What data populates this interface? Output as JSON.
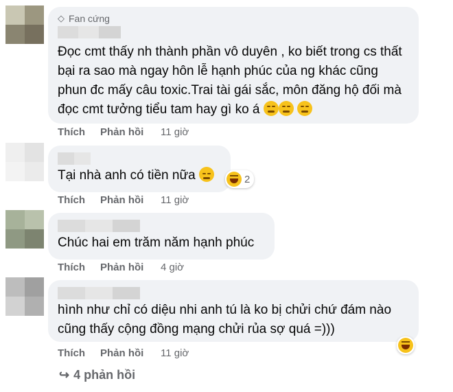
{
  "comments": [
    {
      "badge": "Fan cứng",
      "text": "Đọc cmt thấy nh thành phần vô duyên       , ko biết trong cs thất bại ra sao mà ngay hôn lễ hạnh phúc của ng khác cũng phun đc mấy câu toxic.Trai tài gái sắc, môn đăng hộ đối mà đọc cmt tưởng tiểu tam hay gì ko á",
      "like": "Thích",
      "reply": "Phản hồi",
      "time": "11 giờ"
    },
    {
      "text": "Tại nhà anh có tiền nữa",
      "reaction_count": "2",
      "like": "Thích",
      "reply": "Phản hồi",
      "time": "11 giờ"
    },
    {
      "text": "Chúc hai em trăm năm hạnh phúc",
      "like": "Thích",
      "reply": "Phản hồi",
      "time": "4 giờ"
    },
    {
      "text": "hình như chỉ có diệu nhi anh tú là ko bị chửi chứ đám nào cũng thấy cộng đồng mạng chửi rủa sợ quá =)))",
      "like": "Thích",
      "reply": "Phản hồi",
      "time": "11 giờ"
    }
  ],
  "more_replies": "4 phản hồi",
  "colors": {
    "bubble": "#f0f2f5",
    "meta": "#65676b",
    "text": "#050505"
  }
}
